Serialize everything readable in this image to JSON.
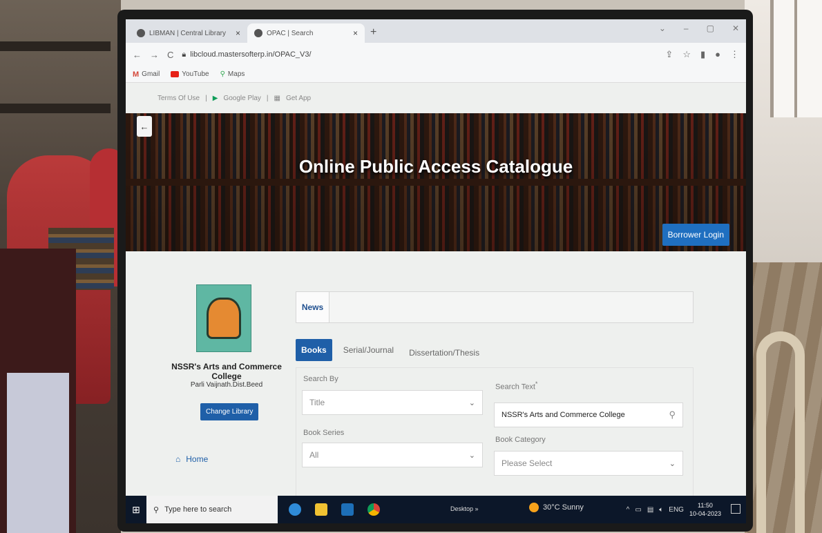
{
  "browser": {
    "tabs": [
      {
        "title": "LIBMAN | Central Library",
        "close": "×",
        "active": false
      },
      {
        "title": "OPAC | Search",
        "close": "×",
        "active": true
      }
    ],
    "new_tab": "+",
    "url": "libcloud.mastersofterp.in/OPAC_V3/",
    "bookmarks": [
      {
        "label": "Gmail",
        "icon": "gmail-icon"
      },
      {
        "label": "YouTube",
        "icon": "youtube-icon"
      },
      {
        "label": "Maps",
        "icon": "maps-icon"
      }
    ]
  },
  "page": {
    "top_links": {
      "terms": "Terms Of Use",
      "sep": "|",
      "google_play": "Google Play",
      "get_app": "Get App"
    },
    "hero": {
      "title": "Online Public Access Catalogue",
      "borrower_login": "Borrower Login",
      "back": "←"
    },
    "library": {
      "college": "NSSR's Arts and Commerce College",
      "place": "Parli Vaijnath.Dist.Beed",
      "change_library": "Change Library",
      "home": "Home"
    },
    "news_label": "News",
    "tabs": [
      "Books",
      "Serial/Journal",
      "Dissertation/Thesis"
    ],
    "form": {
      "search_by_label": "Search By",
      "search_by_value": "Title",
      "search_text_label": "Search Text",
      "search_text_required": "*",
      "search_text_value": "NSSR's Arts and Commerce College",
      "book_series_label": "Book Series",
      "book_series_value": "All",
      "book_category_label": "Book Category",
      "book_category_value": "Please Select"
    }
  },
  "taskbar": {
    "search_placeholder": "Type here to search",
    "desktop": "Desktop",
    "desktop_chevron": "»",
    "weather": "30°C  Sunny",
    "lang": "ENG",
    "time": "11:50",
    "date": "10-04-2023"
  },
  "colors": {
    "primary": "#1f5fa8",
    "taskbar": "#0c1729",
    "hero_button": "#1f6fc0"
  }
}
